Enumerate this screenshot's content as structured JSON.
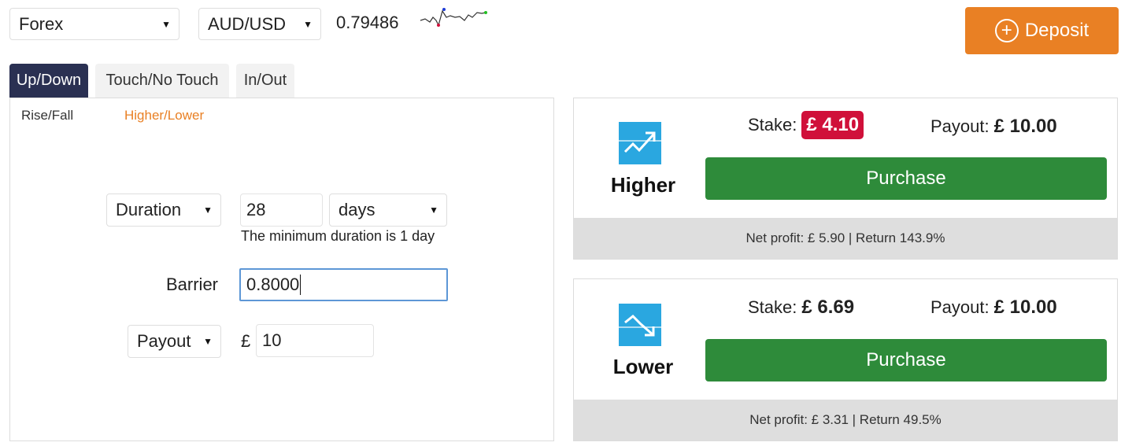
{
  "top": {
    "market": "Forex",
    "symbol": "AUD/USD",
    "spot": "0.79486",
    "deposit_label": "Deposit"
  },
  "tabs": [
    {
      "label": "Up/Down",
      "active": true
    },
    {
      "label": "Touch/No Touch",
      "active": false
    },
    {
      "label": "In/Out",
      "active": false
    }
  ],
  "subtabs": [
    {
      "label": "Rise/Fall",
      "active": false
    },
    {
      "label": "Higher/Lower",
      "active": true
    }
  ],
  "form": {
    "duration_select": "Duration",
    "duration_value": "28",
    "duration_unit": "days",
    "duration_hint": "The minimum duration is 1 day",
    "barrier_label": "Barrier",
    "barrier_value": "0.8000",
    "amount_select": "Payout",
    "currency_symbol": "£",
    "amount_value": "10"
  },
  "contracts": [
    {
      "direction": "Higher",
      "icon": "trend-up-icon",
      "stake_label": "Stake:",
      "stake_value": "£ 4.10",
      "stake_highlight": true,
      "payout_label": "Payout:",
      "payout_value": "£ 10.00",
      "purchase_label": "Purchase",
      "footer": "Net profit: £ 5.90 | Return 143.9%"
    },
    {
      "direction": "Lower",
      "icon": "trend-down-icon",
      "stake_label": "Stake:",
      "stake_value": "£ 6.69",
      "stake_highlight": false,
      "payout_label": "Payout:",
      "payout_value": "£ 10.00",
      "purchase_label": "Purchase",
      "footer": "Net profit: £ 3.31 | Return 49.5%"
    }
  ],
  "colors": {
    "accent_orange": "#e98024",
    "tab_active": "#2a3052",
    "purchase_green": "#2e8b3a",
    "stake_red": "#d0103a",
    "icon_blue": "#2aa7e0"
  }
}
